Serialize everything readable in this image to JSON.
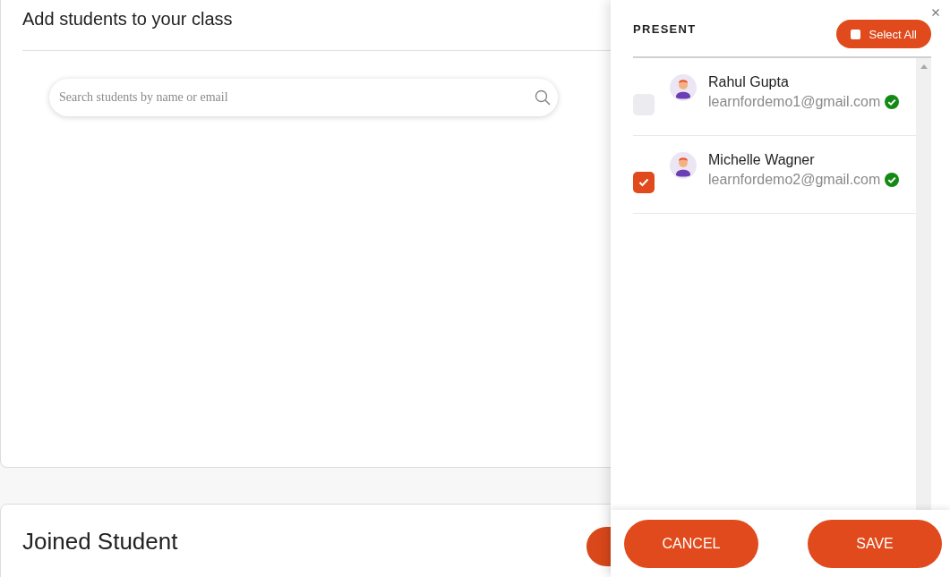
{
  "add_card": {
    "title": "Add students to your class",
    "search": {
      "placeholder": "Search students by name or email"
    }
  },
  "joined_card": {
    "title": "Joined Student"
  },
  "panel": {
    "heading": "PRESENT",
    "select_all": {
      "label": "Select All",
      "checked": false
    },
    "students": [
      {
        "name": "Rahul Gupta",
        "email": "learnfordemo1@gmail.com",
        "verified": true,
        "selected": false
      },
      {
        "name": "Michelle Wagner",
        "email": "learnfordemo2@gmail.com",
        "verified": true,
        "selected": true
      }
    ],
    "buttons": [
      {
        "label": "CANCEL"
      },
      {
        "label": "SAVE"
      }
    ]
  }
}
